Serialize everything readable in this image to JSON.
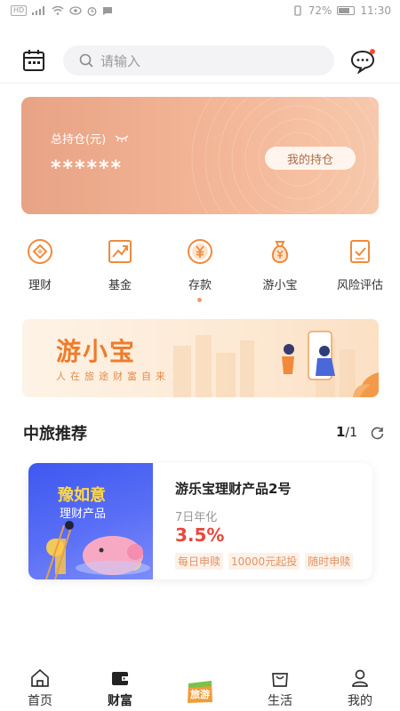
{
  "status_bar": {
    "left_chip": "HD",
    "battery": "72%",
    "time": "11:30"
  },
  "header": {
    "search_placeholder": "请输入"
  },
  "holdings": {
    "label": "总持仓(元)",
    "value": "******",
    "button": "我的持仓"
  },
  "quick_nav": [
    {
      "label": "理财",
      "icon": "coin-diamond-icon"
    },
    {
      "label": "基金",
      "icon": "chart-up-icon"
    },
    {
      "label": "存款",
      "icon": "yen-coin-icon"
    },
    {
      "label": "游小宝",
      "icon": "money-bag-icon"
    },
    {
      "label": "风险评估",
      "icon": "checklist-icon"
    }
  ],
  "banner": {
    "title": "游小宝",
    "subtitle": "人在旅途财富自来"
  },
  "recommend": {
    "title": "中旅推荐",
    "page_current": "1",
    "page_total": "/1",
    "product": {
      "image_title": "豫如意",
      "image_subtitle": "理财产品",
      "name": "游乐宝理财产品2号",
      "rate_label": "7日年化",
      "rate": "3.5%",
      "tags": [
        "每日申赎",
        "10000元起投",
        "随时申赎"
      ]
    }
  },
  "tabbar": {
    "home": "首页",
    "wealth": "财富",
    "center_logo": "旅游",
    "life": "生活",
    "mine": "我的"
  },
  "colors": {
    "accent": "#ef7c2c",
    "rate_red": "#e8483e",
    "card_start": "#e8a385",
    "card_end": "#f7c8ac"
  }
}
